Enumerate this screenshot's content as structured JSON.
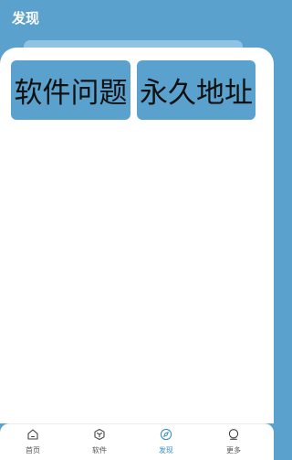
{
  "header": {
    "title": "发现"
  },
  "cards": [
    {
      "label": "软件问题"
    },
    {
      "label": "永久地址"
    }
  ],
  "bottom_nav": {
    "items": [
      {
        "label": "首页",
        "icon": "home-icon"
      },
      {
        "label": "软件",
        "icon": "cube-icon"
      },
      {
        "label": "发现",
        "icon": "compass-icon",
        "active": true
      },
      {
        "label": "更多",
        "icon": "more-icon"
      }
    ]
  },
  "colors": {
    "primary": "#5aa1cd",
    "active": "#3c8fc6",
    "text": "#111111"
  }
}
